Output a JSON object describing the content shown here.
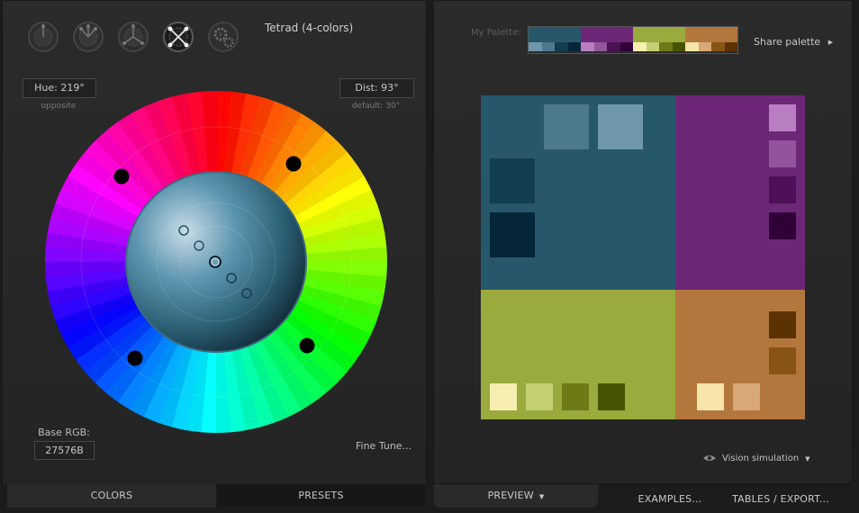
{
  "scheme": {
    "title": "Tetrad (4-colors)",
    "buttons": [
      {
        "name": "mono-scheme-button",
        "active": false
      },
      {
        "name": "adjacent-scheme-button",
        "active": false
      },
      {
        "name": "triad-scheme-button",
        "active": false
      },
      {
        "name": "tetrad-scheme-button",
        "active": true
      },
      {
        "name": "free-style-scheme-button",
        "active": false
      }
    ]
  },
  "controls": {
    "hue_label": "Hue: 219°",
    "hue_sub": "opposite",
    "dist_label": "Dist: 93°",
    "dist_sub": "default: 30°",
    "base_rgb_label": "Base RGB:",
    "base_rgb_value": "27576B",
    "fine_tune": "Fine Tune..."
  },
  "tabs_left": {
    "colors": "COLORS",
    "presets": "PRESETS"
  },
  "tabs_right": {
    "preview": "PREVIEW",
    "examples": "EXAMPLES...",
    "tables": "TABLES / EXPORT..."
  },
  "palette": {
    "label": "My Palette:",
    "share": "Share palette",
    "groups": [
      {
        "main": "#27576b",
        "shades": [
          "#6e97ad",
          "#4b7a8f",
          "#123c4f",
          "#052638"
        ]
      },
      {
        "main": "#6d2777",
        "shades": [
          "#b87ec1",
          "#93549c",
          "#4d0f56",
          "#2f0136"
        ]
      },
      {
        "main": "#9aaa3c",
        "shades": [
          "#f6eeb0",
          "#c4cf74",
          "#6e7a16",
          "#475300"
        ]
      },
      {
        "main": "#b3773d",
        "shades": [
          "#f7e5ab",
          "#d9a878",
          "#885414",
          "#5b3201"
        ]
      }
    ]
  },
  "preview": {
    "vision_label": "Vision simulation",
    "blue": {
      "bg": "#27576b",
      "swatches": [
        "#4b7a8f",
        "#6e97ad",
        "#123c4f",
        "#052638"
      ]
    },
    "purple": {
      "bg": "#6d2777",
      "swatches": [
        "#b87ec1",
        "#93549c",
        "#4d0f56",
        "#2f0136"
      ]
    },
    "green": {
      "bg": "#9aaa3c",
      "swatches": [
        "#f6eeb0",
        "#c4cf74",
        "#6e7a16",
        "#475300"
      ]
    },
    "orange": {
      "bg": "#b3773d",
      "swatches": [
        "#5b3201",
        "#885414",
        "#f7e5ab",
        "#d9a878"
      ]
    }
  }
}
